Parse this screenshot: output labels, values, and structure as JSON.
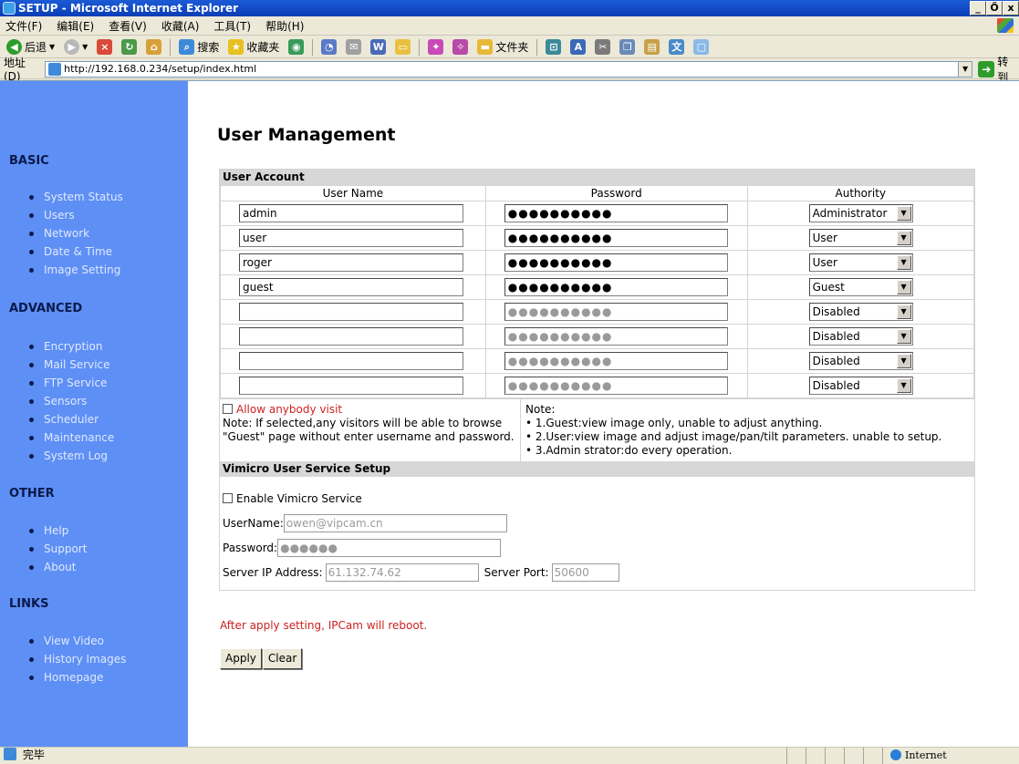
{
  "window": {
    "title": "SETUP - Microsoft Internet Explorer",
    "min": "_",
    "max": "Ő",
    "close": "x"
  },
  "menu": [
    "文件(F)",
    "编辑(E)",
    "查看(V)",
    "收藏(A)",
    "工具(T)",
    "帮助(H)"
  ],
  "toolbar": {
    "back": "后退",
    "search": "搜索",
    "favorites": "收藏夹",
    "folders": "文件夹"
  },
  "address": {
    "label": "地址(D)",
    "url": "http://192.168.0.234/setup/index.html",
    "go": "转到"
  },
  "sidebar": {
    "basic": {
      "title": "BASIC",
      "items": [
        "System Status",
        "Users",
        "Network",
        "Date & Time",
        "Image Setting"
      ]
    },
    "advanced": {
      "title": "ADVANCED",
      "items": [
        "Encryption",
        "Mail Service",
        "FTP Service",
        "Sensors",
        "Scheduler",
        "Maintenance",
        "System Log"
      ]
    },
    "other": {
      "title": "OTHER",
      "items": [
        "Help",
        "Support",
        "About"
      ]
    },
    "links": {
      "title": "LINKS",
      "items": [
        "View Video",
        "History Images",
        "Homepage"
      ]
    }
  },
  "page": {
    "title": "User Management",
    "account_header": "User Account",
    "columns": [
      "User Name",
      "Password",
      "Authority"
    ],
    "users": [
      {
        "name": "admin",
        "password": "●●●●●●●●●●",
        "authority": "Administrator"
      },
      {
        "name": "user",
        "password": "●●●●●●●●●●",
        "authority": "User"
      },
      {
        "name": "roger",
        "password": "●●●●●●●●●●",
        "authority": "User"
      },
      {
        "name": "guest",
        "password": "●●●●●●●●●●",
        "authority": "Guest"
      },
      {
        "name": "",
        "password": "●●●●●●●●●●",
        "authority": "Disabled"
      },
      {
        "name": "",
        "password": "●●●●●●●●●●",
        "authority": "Disabled"
      },
      {
        "name": "",
        "password": "●●●●●●●●●●",
        "authority": "Disabled"
      },
      {
        "name": "",
        "password": "●●●●●●●●●●",
        "authority": "Disabled"
      }
    ],
    "allow_visit_label": "Allow anybody visit",
    "allow_visit_note": "Note: If selected,any visitors will be able to browse \"Guest\" page without enter username and password.",
    "note_title": "Note:",
    "notes": [
      "1.Guest:view image only, unable to adjust anything.",
      "2.User:view image and adjust image/pan/tilt parameters. unable to setup.",
      "3.Admin strator:do every operation."
    ],
    "vimicro_header": "Vimicro User Service Setup",
    "enable_vimicro_label": "Enable Vimicro Service",
    "username_label": "UserName:",
    "username_value": "owen@vipcam.cn",
    "password_label": "Password:",
    "password_value": "●●●●●●",
    "server_ip_label": "Server IP Address:",
    "server_ip_value": "61.132.74.62",
    "server_port_label": "Server Port:",
    "server_port_value": "50600",
    "reboot_note": "After apply setting, IPCam will reboot.",
    "apply_label": "Apply",
    "clear_label": "Clear"
  },
  "status": {
    "text": "完毕",
    "zone": "Internet"
  }
}
